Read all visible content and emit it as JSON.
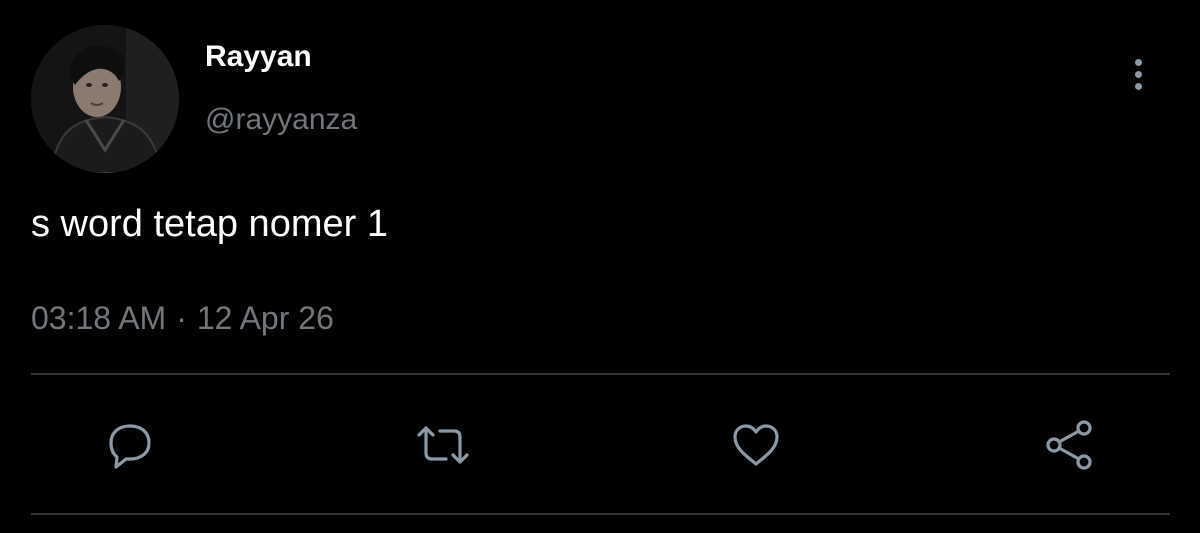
{
  "tweet": {
    "display_name": "Rayyan",
    "handle": "@rayyanza",
    "text": "s word tetap nomer 1",
    "time": "03:18 AM",
    "separator": "·",
    "date": "12 Apr 26"
  },
  "icons": {
    "more": "more-vertical-icon",
    "reply": "reply-icon",
    "retweet": "retweet-icon",
    "like": "heart-icon",
    "share": "share-icon"
  },
  "colors": {
    "background": "#000000",
    "primary_text": "#ffffff",
    "secondary_text": "#71767b",
    "icon": "#8b98a5",
    "divider": "#2f3336"
  }
}
